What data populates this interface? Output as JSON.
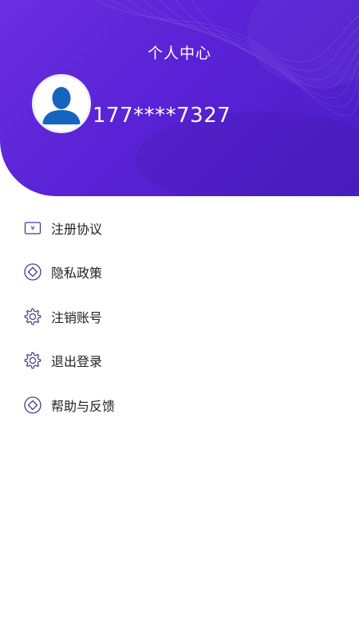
{
  "header": {
    "title": "个人中心",
    "phone": "177****7327"
  },
  "colors": {
    "header_gradient_start": "#6a2fe0",
    "header_gradient_end": "#4a1ec8",
    "icon_stroke": "#3c3c8c"
  },
  "menu": [
    {
      "label": "注册协议",
      "icon": "yuan-card-icon"
    },
    {
      "label": "隐私政策",
      "icon": "diamond-circle-icon"
    },
    {
      "label": "注销账号",
      "icon": "gear-icon"
    },
    {
      "label": "退出登录",
      "icon": "gear-icon"
    },
    {
      "label": "帮助与反馈",
      "icon": "diamond-circle-icon"
    }
  ]
}
